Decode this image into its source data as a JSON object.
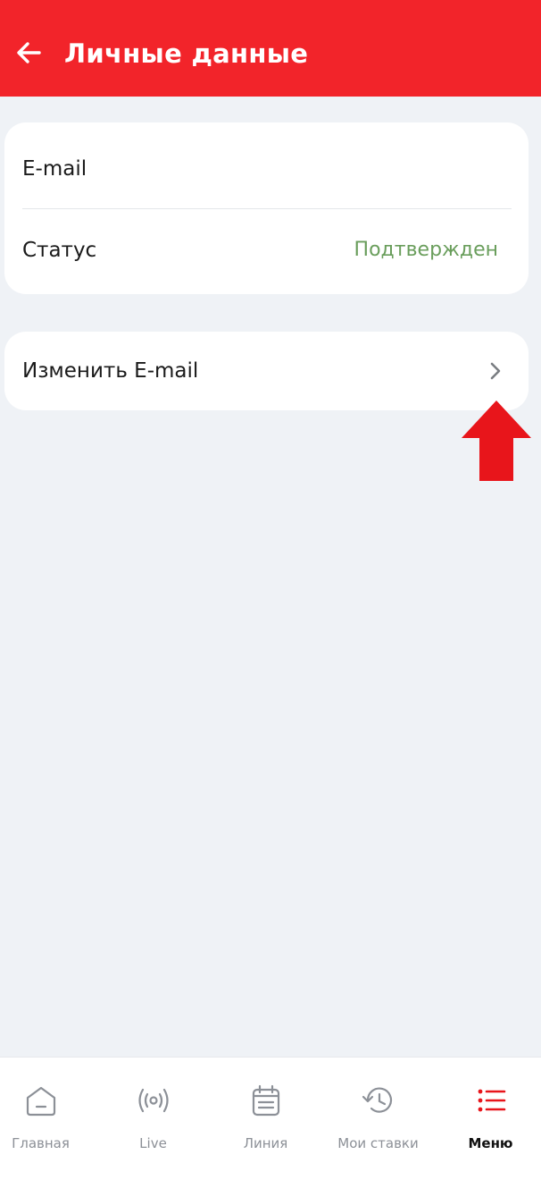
{
  "header": {
    "title": "Личные данные",
    "background_color": "#f2242a"
  },
  "info_card": {
    "email_label": "E-mail",
    "status_label": "Статус",
    "status_value": "Подтвержден",
    "status_color": "#6a9e5c"
  },
  "change_card": {
    "label": "Изменить E-mail"
  },
  "annotation": {
    "arrow_color": "#e8151b",
    "arrow_direction": "up"
  },
  "bottom_nav": {
    "items": [
      {
        "label": "Главная",
        "icon": "home-icon",
        "active": false
      },
      {
        "label": "Live",
        "icon": "broadcast-icon",
        "active": false
      },
      {
        "label": "Линия",
        "icon": "calendar-icon",
        "active": false
      },
      {
        "label": "Мои ставки",
        "icon": "history-icon",
        "active": false
      },
      {
        "label": "Меню",
        "icon": "menu-list-icon",
        "active": true
      }
    ],
    "active_color": "#e8151b",
    "inactive_color": "#8c9097"
  }
}
